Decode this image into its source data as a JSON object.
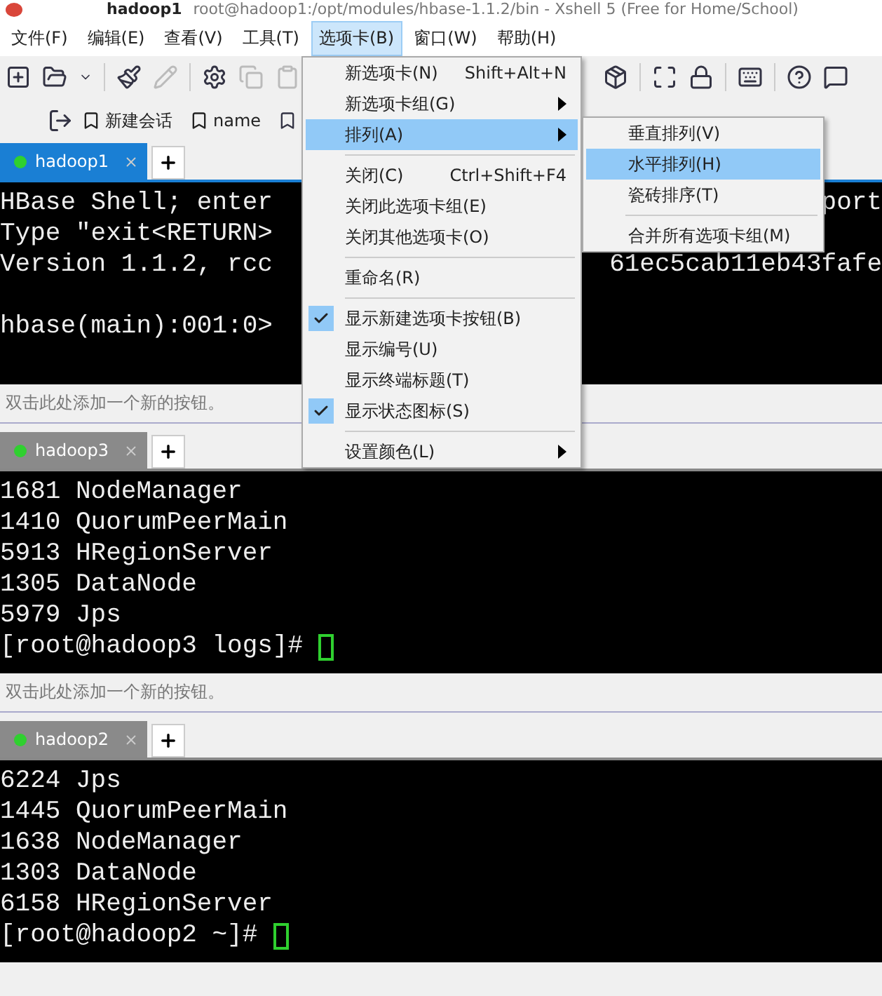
{
  "window": {
    "session": "hadoop1",
    "title": "root@hadoop1:/opt/modules/hbase-1.1.2/bin - Xshell 5 (Free for Home/School)"
  },
  "menubar": [
    {
      "label": "文件(F)",
      "selected": false
    },
    {
      "label": "编辑(E)",
      "selected": false
    },
    {
      "label": "查看(V)",
      "selected": false
    },
    {
      "label": "工具(T)",
      "selected": false
    },
    {
      "label": "选项卡(B)",
      "selected": true
    },
    {
      "label": "窗口(W)",
      "selected": false
    },
    {
      "label": "帮助(H)",
      "selected": false
    }
  ],
  "links": [
    "新建会话",
    "name"
  ],
  "panes": [
    {
      "tab": {
        "label": "hadoop1",
        "selected": true,
        "color": "#2fd02f"
      },
      "lines": [
        {
          "kind": "output",
          "text": "HBase Shell; enter",
          "tail": "port"
        },
        {
          "kind": "output",
          "text": "Type \"exit<RETURN>"
        },
        {
          "kind": "output",
          "text": "Version 1.1.2, rcc",
          "tail": "61ec5cab11eb43fafe"
        },
        {
          "kind": "blank"
        },
        {
          "kind": "prompt",
          "text": "hbase(main):001:0>",
          "cursor": false
        }
      ],
      "quick_bar": "双击此处添加一个新的按钮。"
    },
    {
      "tab": {
        "label": "hadoop3",
        "selected": false,
        "color": "#2fd02f"
      },
      "lines": [
        {
          "kind": "output",
          "text": "1681 NodeManager"
        },
        {
          "kind": "output",
          "text": "1410 QuorumPeerMain"
        },
        {
          "kind": "output",
          "text": "5913 HRegionServer"
        },
        {
          "kind": "output",
          "text": "1305 DataNode"
        },
        {
          "kind": "output",
          "text": "5979 Jps"
        },
        {
          "kind": "prompt",
          "text": "[root@hadoop3 logs]#",
          "cursor": true
        }
      ],
      "quick_bar": "双击此处添加一个新的按钮。"
    },
    {
      "tab": {
        "label": "hadoop2",
        "selected": false,
        "color": "#2fd02f"
      },
      "lines": [
        {
          "kind": "output",
          "text": "6224 Jps"
        },
        {
          "kind": "output",
          "text": "1445 QuorumPeerMain"
        },
        {
          "kind": "output",
          "text": "1638 NodeManager"
        },
        {
          "kind": "output",
          "text": "1303 DataNode"
        },
        {
          "kind": "output",
          "text": "6158 HRegionServer"
        },
        {
          "kind": "prompt",
          "text": "[root@hadoop2 ~]#",
          "cursor": true
        }
      ]
    }
  ],
  "menu": {
    "items": [
      {
        "kind": "item",
        "label": "新选项卡(N)",
        "shortcut": "Shift+Alt+N",
        "checked": false,
        "submenu": false,
        "selected": false
      },
      {
        "kind": "item",
        "label": "新选项卡组(G)",
        "checked": false,
        "submenu": true,
        "selected": false
      },
      {
        "kind": "item",
        "label": "排列(A)",
        "checked": false,
        "submenu": true,
        "selected": true
      },
      {
        "kind": "separator"
      },
      {
        "kind": "item",
        "label": "关闭(C)",
        "shortcut": "Ctrl+Shift+F4",
        "checked": false,
        "submenu": false,
        "selected": false
      },
      {
        "kind": "item",
        "label": "关闭此选项卡组(E)",
        "checked": false,
        "submenu": false,
        "selected": false
      },
      {
        "kind": "item",
        "label": "关闭其他选项卡(O)",
        "checked": false,
        "submenu": false,
        "selected": false
      },
      {
        "kind": "separator"
      },
      {
        "kind": "item",
        "label": "重命名(R)",
        "checked": false,
        "submenu": false,
        "selected": false
      },
      {
        "kind": "separator"
      },
      {
        "kind": "item",
        "label": "显示新建选项卡按钮(B)",
        "checked": true,
        "submenu": false,
        "selected": false
      },
      {
        "kind": "item",
        "label": "显示编号(U)",
        "checked": false,
        "submenu": false,
        "selected": false
      },
      {
        "kind": "item",
        "label": "显示终端标题(T)",
        "checked": false,
        "submenu": false,
        "selected": false
      },
      {
        "kind": "item",
        "label": "显示状态图标(S)",
        "checked": true,
        "submenu": false,
        "selected": false
      },
      {
        "kind": "separator"
      },
      {
        "kind": "item",
        "label": "设置颜色(L)",
        "checked": false,
        "submenu": true,
        "selected": false
      }
    ],
    "submenu": [
      {
        "kind": "item",
        "label": "垂直排列(V)",
        "selected": false
      },
      {
        "kind": "item",
        "label": "水平排列(H)",
        "selected": true
      },
      {
        "kind": "item",
        "label": "瓷砖排序(T)",
        "selected": false
      },
      {
        "kind": "separator"
      },
      {
        "kind": "item",
        "label": "合并所有选项卡组(M)",
        "selected": false
      }
    ]
  }
}
